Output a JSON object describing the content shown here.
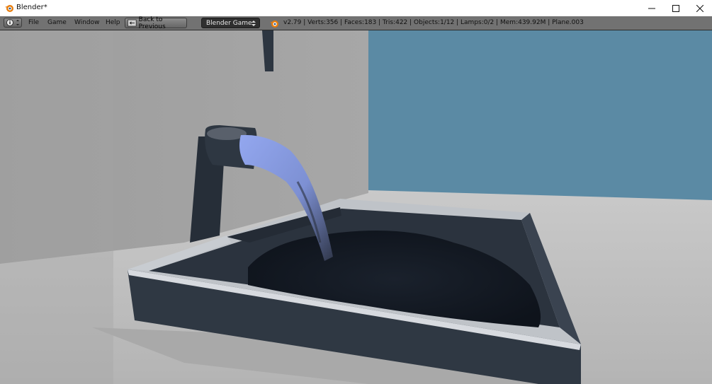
{
  "window": {
    "title": "Blender*",
    "controls": [
      "minimize-icon",
      "maximize-icon",
      "close-icon"
    ]
  },
  "header": {
    "editor_type_icon": "info-icon",
    "menus": [
      "File",
      "Game",
      "Window",
      "Help"
    ],
    "back_button_label": "Back to Previous",
    "render_engine": "Blender Game",
    "blender_logo_icon": "blender-logo-icon",
    "stats": "v2.79 | Verts:356 | Faces:183 | Tris:422 | Objects:1/12 | Lamps:0/2 | Mem:439.92M | Plane.003"
  },
  "viewport": {
    "scene": "Game engine render of a water faucet pouring liquid into a dark sink basin",
    "colors": {
      "sky": "#5a8aa3",
      "wall": "#9a9a9a",
      "floor": "#bdbdbd",
      "sink": "#2c3540",
      "water_stream": "#8a9ee0",
      "pooled_water": "#121821"
    }
  }
}
